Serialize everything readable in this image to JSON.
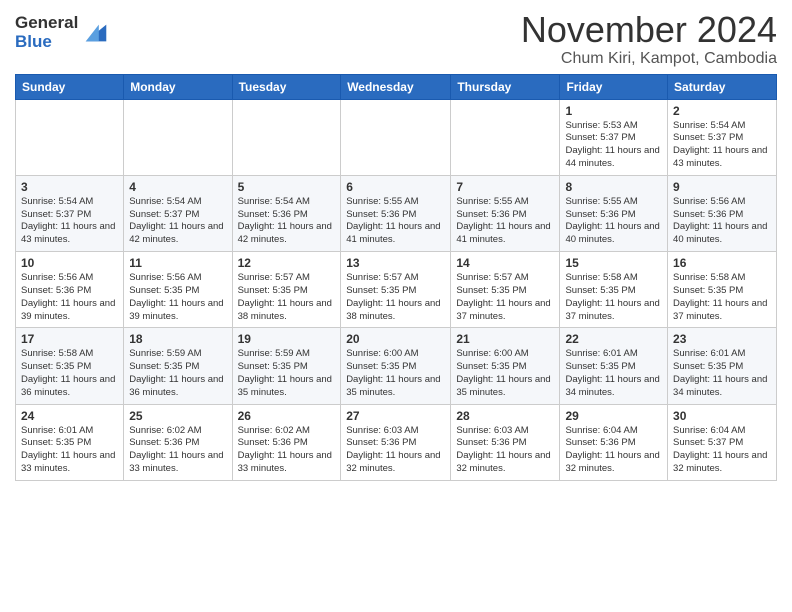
{
  "logo": {
    "line1": "General",
    "line2": "Blue"
  },
  "header": {
    "month": "November 2024",
    "location": "Chum Kiri, Kampot, Cambodia"
  },
  "days_of_week": [
    "Sunday",
    "Monday",
    "Tuesday",
    "Wednesday",
    "Thursday",
    "Friday",
    "Saturday"
  ],
  "weeks": [
    [
      {
        "day": "",
        "info": ""
      },
      {
        "day": "",
        "info": ""
      },
      {
        "day": "",
        "info": ""
      },
      {
        "day": "",
        "info": ""
      },
      {
        "day": "",
        "info": ""
      },
      {
        "day": "1",
        "info": "Sunrise: 5:53 AM\nSunset: 5:37 PM\nDaylight: 11 hours and 44 minutes."
      },
      {
        "day": "2",
        "info": "Sunrise: 5:54 AM\nSunset: 5:37 PM\nDaylight: 11 hours and 43 minutes."
      }
    ],
    [
      {
        "day": "3",
        "info": "Sunrise: 5:54 AM\nSunset: 5:37 PM\nDaylight: 11 hours and 43 minutes."
      },
      {
        "day": "4",
        "info": "Sunrise: 5:54 AM\nSunset: 5:37 PM\nDaylight: 11 hours and 42 minutes."
      },
      {
        "day": "5",
        "info": "Sunrise: 5:54 AM\nSunset: 5:36 PM\nDaylight: 11 hours and 42 minutes."
      },
      {
        "day": "6",
        "info": "Sunrise: 5:55 AM\nSunset: 5:36 PM\nDaylight: 11 hours and 41 minutes."
      },
      {
        "day": "7",
        "info": "Sunrise: 5:55 AM\nSunset: 5:36 PM\nDaylight: 11 hours and 41 minutes."
      },
      {
        "day": "8",
        "info": "Sunrise: 5:55 AM\nSunset: 5:36 PM\nDaylight: 11 hours and 40 minutes."
      },
      {
        "day": "9",
        "info": "Sunrise: 5:56 AM\nSunset: 5:36 PM\nDaylight: 11 hours and 40 minutes."
      }
    ],
    [
      {
        "day": "10",
        "info": "Sunrise: 5:56 AM\nSunset: 5:36 PM\nDaylight: 11 hours and 39 minutes."
      },
      {
        "day": "11",
        "info": "Sunrise: 5:56 AM\nSunset: 5:35 PM\nDaylight: 11 hours and 39 minutes."
      },
      {
        "day": "12",
        "info": "Sunrise: 5:57 AM\nSunset: 5:35 PM\nDaylight: 11 hours and 38 minutes."
      },
      {
        "day": "13",
        "info": "Sunrise: 5:57 AM\nSunset: 5:35 PM\nDaylight: 11 hours and 38 minutes."
      },
      {
        "day": "14",
        "info": "Sunrise: 5:57 AM\nSunset: 5:35 PM\nDaylight: 11 hours and 37 minutes."
      },
      {
        "day": "15",
        "info": "Sunrise: 5:58 AM\nSunset: 5:35 PM\nDaylight: 11 hours and 37 minutes."
      },
      {
        "day": "16",
        "info": "Sunrise: 5:58 AM\nSunset: 5:35 PM\nDaylight: 11 hours and 37 minutes."
      }
    ],
    [
      {
        "day": "17",
        "info": "Sunrise: 5:58 AM\nSunset: 5:35 PM\nDaylight: 11 hours and 36 minutes."
      },
      {
        "day": "18",
        "info": "Sunrise: 5:59 AM\nSunset: 5:35 PM\nDaylight: 11 hours and 36 minutes."
      },
      {
        "day": "19",
        "info": "Sunrise: 5:59 AM\nSunset: 5:35 PM\nDaylight: 11 hours and 35 minutes."
      },
      {
        "day": "20",
        "info": "Sunrise: 6:00 AM\nSunset: 5:35 PM\nDaylight: 11 hours and 35 minutes."
      },
      {
        "day": "21",
        "info": "Sunrise: 6:00 AM\nSunset: 5:35 PM\nDaylight: 11 hours and 35 minutes."
      },
      {
        "day": "22",
        "info": "Sunrise: 6:01 AM\nSunset: 5:35 PM\nDaylight: 11 hours and 34 minutes."
      },
      {
        "day": "23",
        "info": "Sunrise: 6:01 AM\nSunset: 5:35 PM\nDaylight: 11 hours and 34 minutes."
      }
    ],
    [
      {
        "day": "24",
        "info": "Sunrise: 6:01 AM\nSunset: 5:35 PM\nDaylight: 11 hours and 33 minutes."
      },
      {
        "day": "25",
        "info": "Sunrise: 6:02 AM\nSunset: 5:36 PM\nDaylight: 11 hours and 33 minutes."
      },
      {
        "day": "26",
        "info": "Sunrise: 6:02 AM\nSunset: 5:36 PM\nDaylight: 11 hours and 33 minutes."
      },
      {
        "day": "27",
        "info": "Sunrise: 6:03 AM\nSunset: 5:36 PM\nDaylight: 11 hours and 32 minutes."
      },
      {
        "day": "28",
        "info": "Sunrise: 6:03 AM\nSunset: 5:36 PM\nDaylight: 11 hours and 32 minutes."
      },
      {
        "day": "29",
        "info": "Sunrise: 6:04 AM\nSunset: 5:36 PM\nDaylight: 11 hours and 32 minutes."
      },
      {
        "day": "30",
        "info": "Sunrise: 6:04 AM\nSunset: 5:37 PM\nDaylight: 11 hours and 32 minutes."
      }
    ]
  ]
}
